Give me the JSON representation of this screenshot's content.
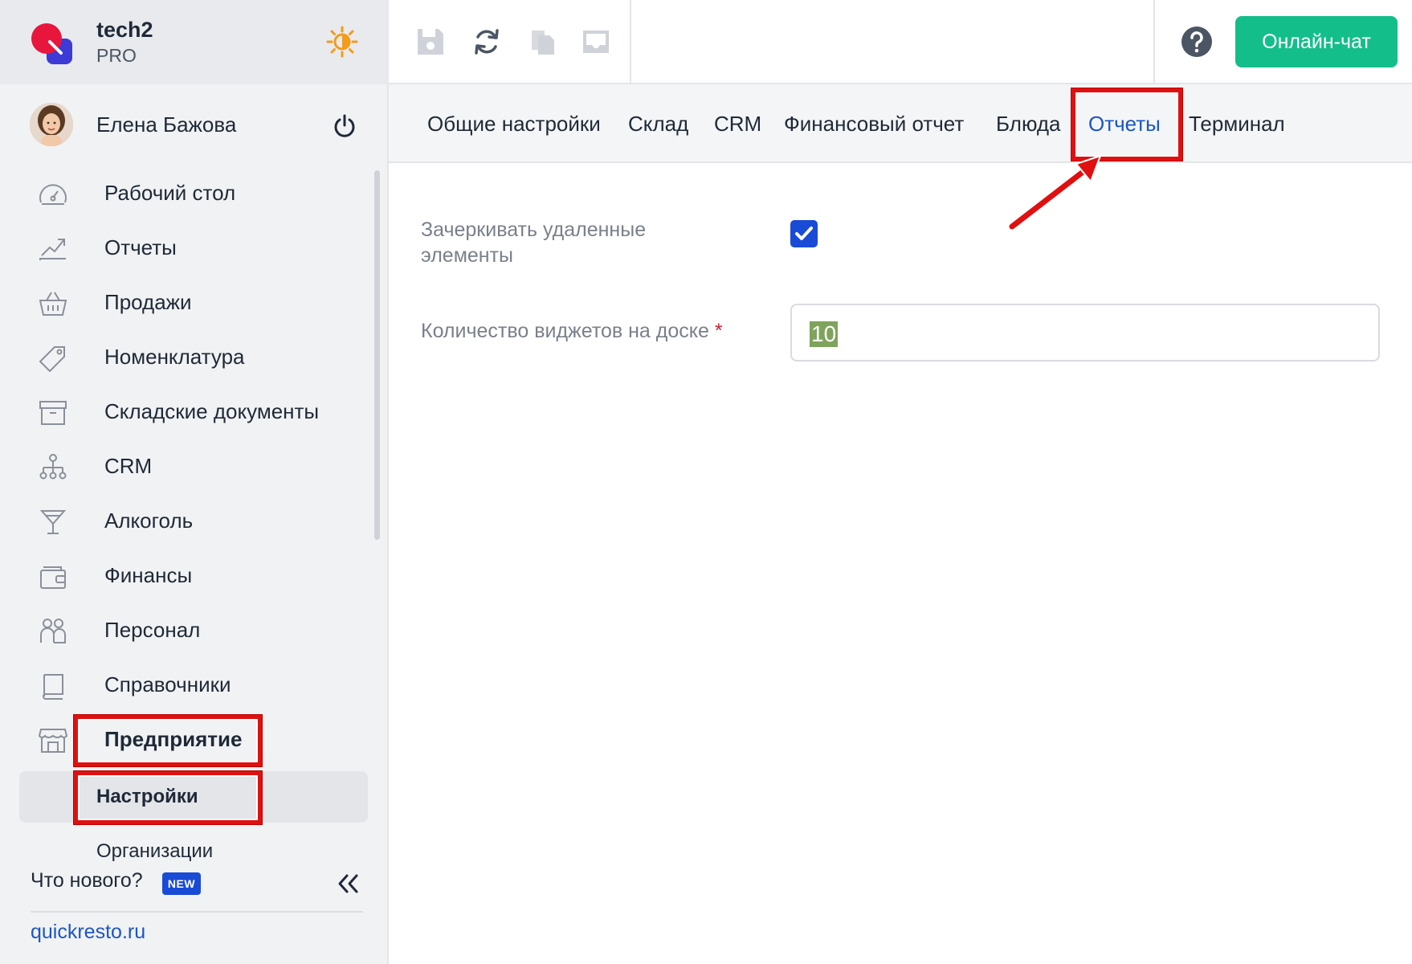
{
  "brand": {
    "name": "tech2",
    "plan": "PRO"
  },
  "user": {
    "name": "Елена Бажова"
  },
  "nav": {
    "items": [
      {
        "label": "Рабочий стол",
        "icon": "gauge-icon"
      },
      {
        "label": "Отчеты",
        "icon": "chart-trend-icon"
      },
      {
        "label": "Продажи",
        "icon": "basket-icon"
      },
      {
        "label": "Номенклатура",
        "icon": "tag-icon"
      },
      {
        "label": "Складские документы",
        "icon": "archive-box-icon"
      },
      {
        "label": "CRM",
        "icon": "org-chart-icon"
      },
      {
        "label": "Алкоголь",
        "icon": "cocktail-icon"
      },
      {
        "label": "Финансы",
        "icon": "wallet-icon"
      },
      {
        "label": "Персонал",
        "icon": "people-icon"
      },
      {
        "label": "Справочники",
        "icon": "book-icon"
      },
      {
        "label": "Предприятие",
        "icon": "store-icon"
      }
    ],
    "sub_items": [
      {
        "label": "Настройки",
        "active": true
      },
      {
        "label": "Организации",
        "active": false
      }
    ]
  },
  "footer": {
    "whats_new": "Что нового?",
    "new_badge": "NEW",
    "site": "quickresto.ru"
  },
  "toolbar": {
    "icons": [
      "save-icon",
      "sync-icon",
      "copy-icon",
      "inbox-icon"
    ],
    "help_icon": "help-icon",
    "chat_button": "Онлайн-чат"
  },
  "tabs": [
    {
      "label": "Общие настройки"
    },
    {
      "label": "Склад"
    },
    {
      "label": "CRM"
    },
    {
      "label": "Финансовый отчет"
    },
    {
      "label": "Блюда"
    },
    {
      "label": "Отчеты",
      "active": true
    },
    {
      "label": "Терминал"
    }
  ],
  "form": {
    "strike_deleted": {
      "label_line1": "Зачеркивать удаленные",
      "label_line2": "элементы",
      "checked": true
    },
    "widgets_count": {
      "label": "Количество виджетов на доске",
      "required_mark": "*",
      "value": "10"
    }
  },
  "colors": {
    "accent": "#1a56c4",
    "chat": "#14be8a",
    "highlight": "#e01010"
  }
}
